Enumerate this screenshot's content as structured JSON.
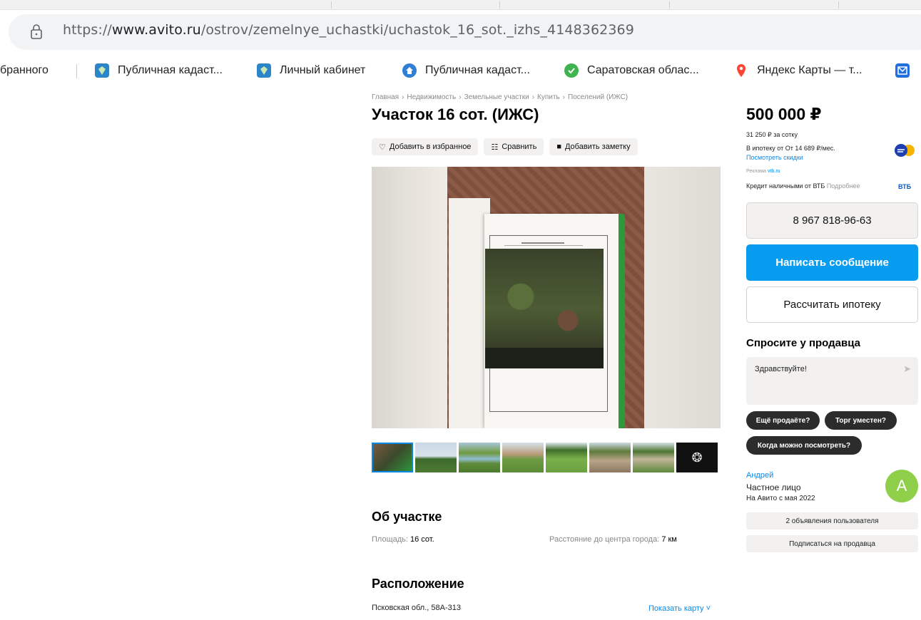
{
  "browser": {
    "url_prefix": "https://",
    "url_domain": "www.avito.ru",
    "url_path": "/ostrov/zemelnye_uchastki/uchastok_16_sot._izhs_4148362369",
    "bookmarks": [
      {
        "label": "бранного"
      },
      {
        "label": "Публичная кадаст...",
        "icon": "cadastre-icon"
      },
      {
        "label": "Личный кабинет",
        "icon": "cadastre-icon"
      },
      {
        "label": "Публичная кадаст...",
        "icon": "home-icon"
      },
      {
        "label": "Саратовская облас...",
        "icon": "check-icon"
      },
      {
        "label": "Яндекс Карты — т...",
        "icon": "map-pin-icon"
      },
      {
        "label": "",
        "icon": "mail-icon"
      }
    ]
  },
  "listing": {
    "breadcrumbs": [
      "Главная",
      "Недвижимость",
      "Земельные участки",
      "Купить",
      "Поселений (ИЖС)"
    ],
    "breadcrumb_sep": "›",
    "title": "Участок 16 сот. (ИЖС)",
    "actions": {
      "favorite": "Добавить в избранное",
      "compare": "Сравнить",
      "note": "Добавить заметку"
    },
    "thumbs_more_icon": "gallery-more-icon"
  },
  "about": {
    "heading": "Об участке",
    "area_label": "Площадь:",
    "area_value": "16 сот.",
    "distance_label": "Расстояние до центра города:",
    "distance_value": "7 км"
  },
  "location": {
    "heading": "Расположение",
    "address": "Псковская обл., 58А-313",
    "show_map": "Показать карту ˅"
  },
  "sidebar": {
    "price": "500 000 ₽",
    "price_per": "31 250 ₽ за сотку",
    "mortgage_text": "В ипотеку от От 14 689 ₽/мес.",
    "discounts_link": "Посмотреть скидки",
    "ad_label": "Реклама",
    "ad_domain": "vtb.ru",
    "credit_text": "Кредит наличными от ВТБ",
    "credit_more": "Подробнее",
    "vtb_logo": "ВТБ",
    "phone": "8 967 818-96-63",
    "message_button": "Написать сообщение",
    "mortgage_button": "Рассчитать ипотеку",
    "ask": {
      "title": "Спросите у продавца",
      "message": "Здравствуйте!",
      "chips": [
        "Ещё продаёте?",
        "Торг уместен?",
        "Когда можно посмотреть?"
      ]
    },
    "seller": {
      "name": "Андрей",
      "type": "Частное лицо",
      "since": "На Авито с мая 2022",
      "avatar_letter": "A",
      "ads_button": "2 объявления пользователя",
      "subscribe_button": "Подписаться на продавца"
    }
  },
  "colors": {
    "accent_blue": "#089cf1",
    "link_blue": "#0a88e6",
    "avatar_green": "#8fcf4a"
  }
}
